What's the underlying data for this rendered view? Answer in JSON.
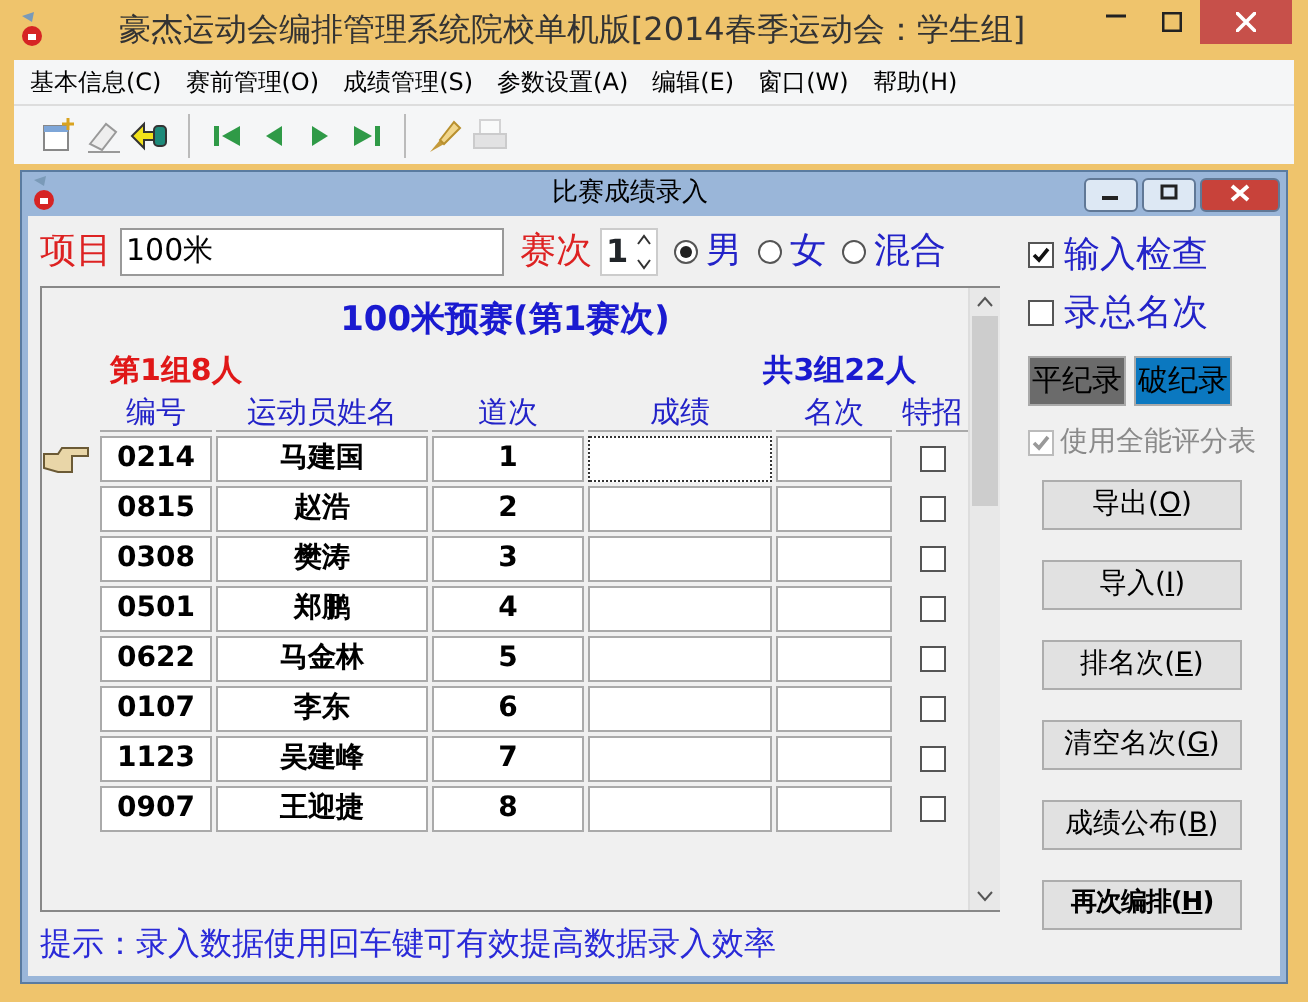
{
  "window": {
    "title": "豪杰运动会编排管理系统院校单机版[2014春季运动会：学生组]"
  },
  "menu": [
    "基本信息(C)",
    "赛前管理(O)",
    "成绩管理(S)",
    "参数设置(A)",
    "编辑(E)",
    "窗口(W)",
    "帮助(H)"
  ],
  "toolbar": [
    {
      "kind": "new",
      "disabled": false
    },
    {
      "kind": "erase",
      "disabled": false
    },
    {
      "kind": "back",
      "disabled": false
    },
    {
      "kind": "sep"
    },
    {
      "kind": "first",
      "disabled": false
    },
    {
      "kind": "prev",
      "disabled": false
    },
    {
      "kind": "next",
      "disabled": false
    },
    {
      "kind": "last",
      "disabled": false
    },
    {
      "kind": "sep"
    },
    {
      "kind": "tool",
      "disabled": false
    },
    {
      "kind": "print",
      "disabled": true
    }
  ],
  "child": {
    "title": "比赛成绩录入"
  },
  "event": {
    "label": "项目",
    "value": "100米"
  },
  "round": {
    "label": "赛次",
    "value": "1"
  },
  "genders": [
    {
      "label": "男",
      "selected": true
    },
    {
      "label": "女",
      "selected": false
    },
    {
      "label": "混合",
      "selected": false
    }
  ],
  "sheet": {
    "heading": "100米预赛(第1赛次)",
    "group": "第1组8人",
    "total": "共3组22人",
    "columns": [
      "编号",
      "运动员姓名",
      "道次",
      "成绩",
      "名次",
      "特招"
    ],
    "rows": [
      {
        "id": "0214",
        "name": "马建国",
        "lane": "1",
        "current": true,
        "special": false
      },
      {
        "id": "0815",
        "name": "赵浩",
        "lane": "2",
        "current": false,
        "special": false
      },
      {
        "id": "0308",
        "name": "樊涛",
        "lane": "3",
        "current": false,
        "special": false
      },
      {
        "id": "0501",
        "name": "郑鹏",
        "lane": "4",
        "current": false,
        "special": false
      },
      {
        "id": "0622",
        "name": "马金林",
        "lane": "5",
        "current": false,
        "special": false
      },
      {
        "id": "0107",
        "name": "李东",
        "lane": "6",
        "current": false,
        "special": false
      },
      {
        "id": "1123",
        "name": "吴建峰",
        "lane": "7",
        "current": false,
        "special": false
      },
      {
        "id": "0907",
        "name": "王迎捷",
        "lane": "8",
        "current": false,
        "special": false
      }
    ]
  },
  "options": [
    {
      "label": "输入检查",
      "checked": true
    },
    {
      "label": "录总名次",
      "checked": false
    }
  ],
  "records": [
    {
      "label": "平纪录",
      "color": "#6b6b6b"
    },
    {
      "label": "破纪录",
      "color": "#0b78c0"
    }
  ],
  "decathlon": {
    "label": "使用全能评分表",
    "checked": true,
    "disabled": true
  },
  "buttons": [
    {
      "before": "导出(",
      "key": "O",
      "after": ")",
      "bold": false
    },
    {
      "before": "导入(",
      "key": "I",
      "after": ")",
      "bold": false
    },
    {
      "before": "排名次(",
      "key": "E",
      "after": ")",
      "bold": false
    },
    {
      "before": "清空名次(",
      "key": "G",
      "after": ")",
      "bold": false
    },
    {
      "before": "成绩公布(",
      "key": "B",
      "after": ")",
      "bold": false
    },
    {
      "before": "再次编排(",
      "key": "H",
      "after": ")",
      "bold": true
    }
  ],
  "hint": "提示：录入数据使用回车键可有效提高数据录入效率"
}
